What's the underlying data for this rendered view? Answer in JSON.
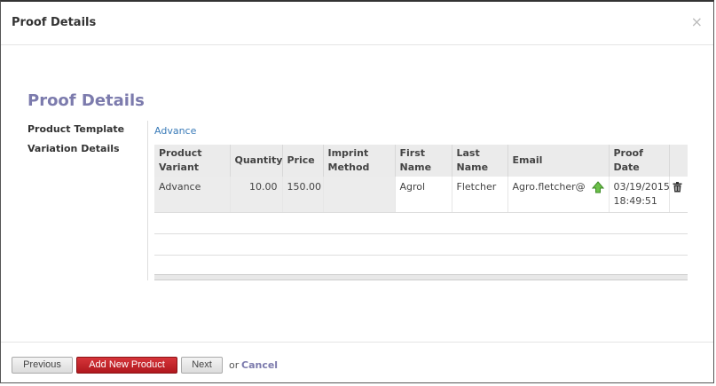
{
  "dialog": {
    "title": "Proof Details",
    "close_symbol": "×"
  },
  "form": {
    "section_title": "Proof Details",
    "product_template_label": "Product Template",
    "product_template_value": "Advance",
    "variation_details_label": "Variation Details"
  },
  "grid": {
    "columns": [
      "Product Variant",
      "Quantity",
      "Price",
      "Imprint Method",
      "First Name",
      "Last Name",
      "Email",
      "Proof Date"
    ],
    "rows": [
      {
        "product_variant": "Advance",
        "quantity": "10.00",
        "price": "150.00",
        "imprint_method": "",
        "first_name": "Agrol",
        "last_name": "Fletcher",
        "email": "Agro.fletcher@",
        "upload_icon": "upload-arrow-icon",
        "proof_date": "03/19/2015 18:49:51",
        "delete_icon": "trash-icon"
      }
    ]
  },
  "footer": {
    "previous_label": "Previous",
    "add_new_label": "Add New Product",
    "next_label": "Next",
    "or_text": "or",
    "cancel_label": "Cancel"
  },
  "colors": {
    "title_accent": "#7c7bad",
    "link": "#3a7bb8",
    "primary_button": "#c0232a"
  }
}
